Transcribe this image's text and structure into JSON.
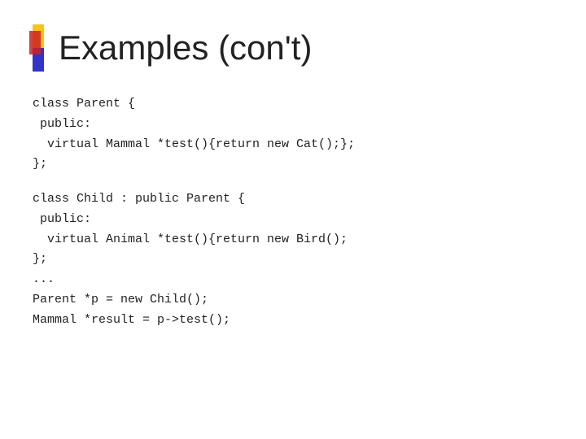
{
  "slide": {
    "title": "Examples (con't)",
    "code_sections": [
      {
        "id": "parent-class",
        "lines": [
          "class Parent {",
          " public:",
          "  virtual Mammal *test(){return new Cat();};",
          "};"
        ]
      },
      {
        "id": "child-class",
        "lines": [
          "class Child : public Parent {",
          " public:",
          "  virtual Animal *test(){return new Bird();",
          "};",
          "...",
          "Parent *p = new Child();",
          "Mammal *result = p->test();"
        ]
      }
    ]
  }
}
